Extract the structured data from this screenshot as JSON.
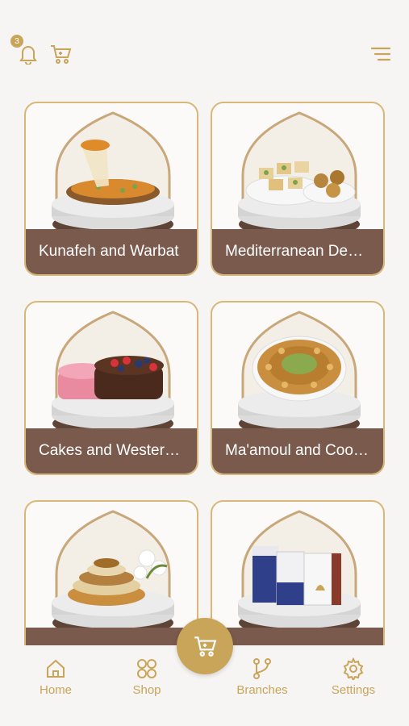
{
  "header": {
    "notification_count": "3"
  },
  "categories": [
    {
      "label": "Kunafeh and Warbat"
    },
    {
      "label": "Mediterranean Desserts"
    },
    {
      "label": "Cakes and Western Sweets"
    },
    {
      "label": "Ma'amoul and Cookies"
    },
    {
      "label": ""
    },
    {
      "label": ""
    }
  ],
  "nav": {
    "home": "Home",
    "shop": "Shop",
    "branches": "Branches",
    "settings": "Settings"
  },
  "colors": {
    "gold": "#c9a55a",
    "brown": "#7a5a4d"
  }
}
